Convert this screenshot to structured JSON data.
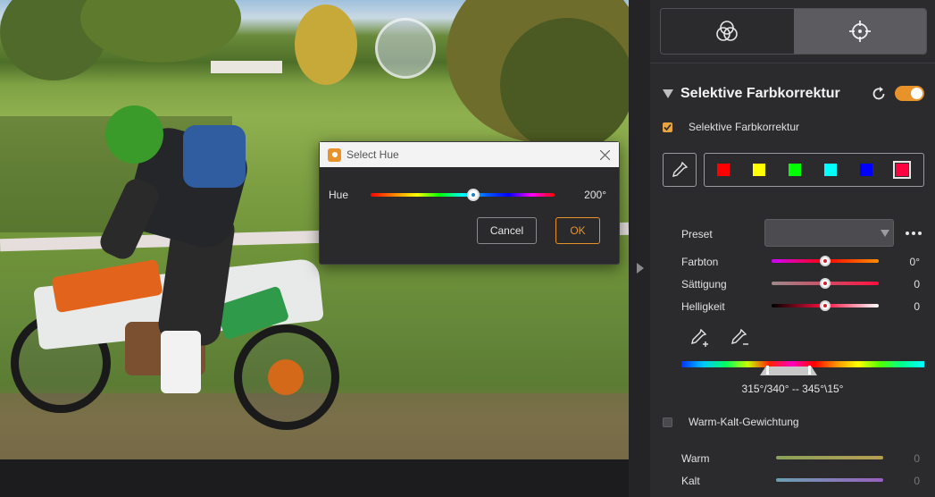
{
  "dialog": {
    "title": "Select Hue",
    "hue_label": "Hue",
    "hue_value": "200°",
    "hue_fraction": 0.556,
    "cancel_label": "Cancel",
    "ok_label": "OK"
  },
  "panel": {
    "tabs": [
      {
        "icon": "color-circles-icon",
        "active": false
      },
      {
        "icon": "crosshair-icon",
        "active": true
      }
    ],
    "section_title": "Selektive Farbkorrektur",
    "enabled_checkbox_label": "Selektive Farbkorrektur",
    "toggle_on": true,
    "swatches": [
      "#ff0000",
      "#ffff00",
      "#00ff00",
      "#00ffff",
      "#0000ff",
      "#ff0040"
    ],
    "selected_swatch_index": 5,
    "preset_label": "Preset",
    "preset_value": "",
    "sliders": [
      {
        "label": "Farbton",
        "value": "0°",
        "fraction": 0.5
      },
      {
        "label": "Sättigung",
        "value": "0",
        "fraction": 0.5
      },
      {
        "label": "Helligkeit",
        "value": "0",
        "fraction": 0.5
      }
    ],
    "range_text": "315°/340° -- 345°\\15°",
    "warm_cold_label": "Warm-Kalt-Gewichtung",
    "warm_label": "Warm",
    "warm_value": "0",
    "kalt_label": "Kalt",
    "kalt_value": "0"
  },
  "colors": {
    "accent": "#e8922a",
    "panel_bg": "#2b2b2e"
  }
}
